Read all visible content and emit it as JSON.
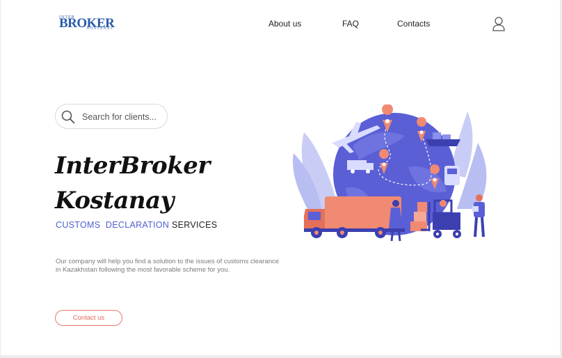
{
  "header": {
    "logo": {
      "top_text": "INTER",
      "main_text": "BROKER",
      "sub_text": "KOSTANAY"
    },
    "nav": [
      {
        "label": "About us"
      },
      {
        "label": "FAQ"
      },
      {
        "label": "Contacts"
      }
    ],
    "user_icon": "user-icon"
  },
  "search": {
    "placeholder": "Search for clients...",
    "icon": "search-icon"
  },
  "hero": {
    "title_line1": "InterBroker",
    "title_line2": "Kostanay",
    "tagline_blue": "CUSTOMS  DECLARATION",
    "tagline_dark": "SERVICES",
    "description": "Our company will help you find a solution to the issues of customs clearance in Kazakhstan following the most favorable scheme for you.",
    "contact_button": "Contact us"
  },
  "colors": {
    "accent_blue": "#4f5fd0",
    "logo_blue": "#2a5ca8",
    "accent_coral": "#e06a5c",
    "globe": "#5b5fd6"
  }
}
